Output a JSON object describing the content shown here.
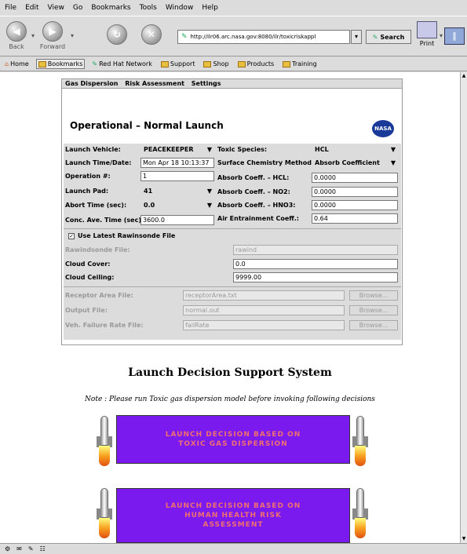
{
  "menu": [
    "File",
    "Edit",
    "View",
    "Go",
    "Bookmarks",
    "Tools",
    "Window",
    "Help"
  ],
  "nav": {
    "back": "Back",
    "forward": "Forward",
    "url": "http://ilr06.arc.nasa.gov:8080/ilr/toxicriskappl",
    "search": "Search",
    "print": "Print"
  },
  "bookmarks": [
    "Home",
    "Bookmarks",
    "Red Hat Network",
    "Support",
    "Shop",
    "Products",
    "Training"
  ],
  "tabs": [
    "Gas Dispersion",
    "Risk Assessment",
    "Settings"
  ],
  "form": {
    "title": "Operational – Normal Launch",
    "logo": "NASA",
    "launch_vehicle_label": "Launch Vehicle:",
    "launch_vehicle": "PEACEKEEPER",
    "launch_time_label": "Launch Time/Date:",
    "launch_time": "Mon Apr 18 10:13:37",
    "operation_label": "Operation #:",
    "operation": "1",
    "launch_pad_label": "Launch Pad:",
    "launch_pad": "41",
    "abort_time_label": "Abort Time (sec):",
    "abort_time": "0.0",
    "conc_label": "Conc. Ave. Time (sec):",
    "conc": "3600.0",
    "toxic_species_label": "Toxic Species:",
    "toxic_species": "HCL",
    "surface_label": "Surface Chemistry Method:",
    "surface": "Absorb Coefficient",
    "coeff_hcl_label": "Absorb Coeff. – HCL:",
    "coeff_hcl": "0.0000",
    "coeff_no2_label": "Absorb Coeff. – NO2:",
    "coeff_no2": "0.0000",
    "coeff_hno3_label": "Absorb Coeff. – HNO3:",
    "coeff_hno3": "0.0000",
    "air_label": "Air Entrainment Coeff.:",
    "air": "0.64",
    "rawinsonde_check_label": "Use Latest Rawinsonde File",
    "rawinsonde_file_label": "Rawindsonde File:",
    "rawinsonde_file": "rawind",
    "cloud_cover_label": "Cloud Cover:",
    "cloud_cover": "0.0",
    "cloud_ceiling_label": "Cloud Ceiling:",
    "cloud_ceiling": "9999.00",
    "receptor_label": "Receptor Area File:",
    "receptor": "receptorArea.txt",
    "output_label": "Output File:",
    "output": "normal.out",
    "failure_label": "Veh. Failure Rate File:",
    "failure": "failRate",
    "browse": "Browse..."
  },
  "ldss_title": "Launch Decision Support System",
  "note": "Note : Please run Toxic gas dispersion model before invoking following decisions",
  "decision1": {
    "line1": "LAUNCH DECISION BASED ON",
    "line2": "TOXIC GAS DISPERSION"
  },
  "decision2": {
    "line1": "LAUNCH DECISION BASED ON",
    "line2": "HUMAN HEALTH RISK",
    "line3": "ASSESSMENT"
  },
  "colors": {
    "button_bg": "#7a1aef",
    "button_text": "#f07070",
    "chrome": "#dcdcdc"
  }
}
